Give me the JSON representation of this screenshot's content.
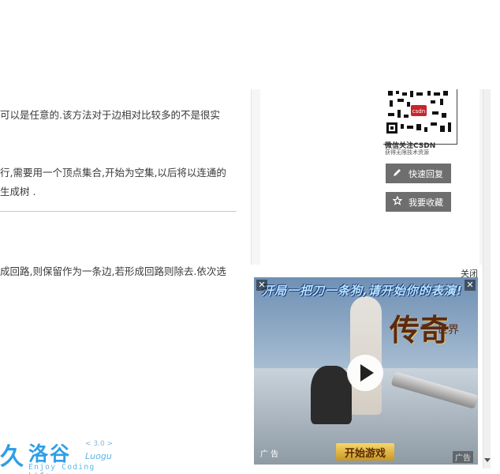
{
  "article": {
    "lines": [
      "可以是任意的.该方法对于边相对比较多的不是很实",
      "行,需要用一个顶点集合,开始为空集,以后将以连通的",
      "生成树 .",
      "成回路,则保留作为一条边,若形成回路则除去.依次选"
    ]
  },
  "sidebar": {
    "qr_caption": "微信关注CSDN",
    "qr_subcaption": "获得无限技术资源",
    "quick_reply_label": "快速回复",
    "favorite_label": "我要收藏",
    "close_label": "关闭"
  },
  "ad": {
    "banner_text": "开局一把刀一条狗,请开始你的表演!",
    "logo_text": "传奇",
    "logo_sub": "世界",
    "start_button": "开始游戏",
    "ad_label": "广 告",
    "ad_label_right": "广告",
    "close_glyph": "✕"
  },
  "watermark": {
    "glyph": "久",
    "name_cn": "洛谷",
    "version": "< 3.0 >",
    "name_en": "Luogu",
    "tagline": "Enjoy Coding Life"
  },
  "colors": {
    "brand": "#2f9ee6",
    "button_bg": "#6e6e6e"
  }
}
